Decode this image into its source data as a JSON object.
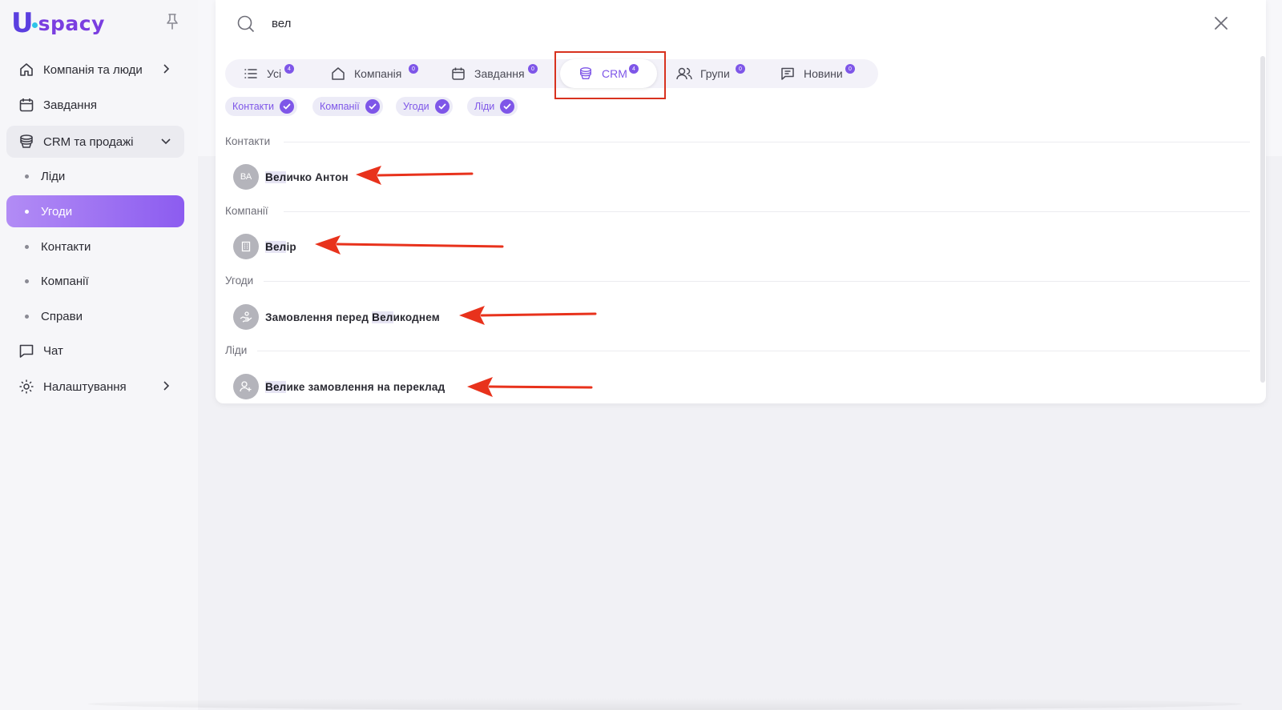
{
  "brand": {
    "logo_letter": "U",
    "logo_word": "spacy",
    "primary_color": "#7e56e8",
    "selected_gradient": [
      "#b28cf5",
      "#8c5cf0"
    ],
    "annotation_color": "#d8321f"
  },
  "sidebar": {
    "items": [
      {
        "label": "Компанія та люди",
        "icon": "home-icon",
        "has_chevron": "right"
      },
      {
        "label": "Завдання",
        "icon": "calendar-icon"
      },
      {
        "label": "CRM та продажі",
        "icon": "database-icon",
        "has_chevron": "down",
        "expanded": true,
        "children": [
          {
            "label": "Ліди"
          },
          {
            "label": "Угоди",
            "selected": true
          },
          {
            "label": "Контакти"
          },
          {
            "label": "Компанії"
          },
          {
            "label": "Справи"
          }
        ]
      },
      {
        "label": "Чат",
        "icon": "chat-icon"
      },
      {
        "label": "Налаштування",
        "icon": "gear-icon",
        "has_chevron": "right"
      }
    ]
  },
  "search": {
    "query": "вел",
    "tabs": [
      {
        "label": "Усі",
        "count": "4",
        "icon": "list-icon"
      },
      {
        "label": "Компанія",
        "count": "0",
        "icon": "home-icon"
      },
      {
        "label": "Завдання",
        "count": "0",
        "icon": "calendar-icon"
      },
      {
        "label": "CRM",
        "count": "4",
        "icon": "database-icon",
        "active": true
      },
      {
        "label": "Групи",
        "count": "0",
        "icon": "users-icon"
      },
      {
        "label": "Новини",
        "count": "0",
        "icon": "message-icon"
      }
    ],
    "filters": [
      {
        "label": "Контакти",
        "checked": true
      },
      {
        "label": "Компанії",
        "checked": true
      },
      {
        "label": "Угоди",
        "checked": true
      },
      {
        "label": "Ліди",
        "checked": true
      }
    ],
    "sections": [
      {
        "title": "Контакти",
        "result": {
          "avatar_text": "ВА",
          "match": "Вел",
          "rest_before": "",
          "rest_after": "ичко Антон"
        }
      },
      {
        "title": "Компанії",
        "result": {
          "avatar_icon": "building-icon",
          "match": "Вел",
          "rest_before": "",
          "rest_after": "ір"
        }
      },
      {
        "title": "Угоди",
        "result": {
          "avatar_icon": "handshake-icon",
          "match": "Вел",
          "rest_before": "Замовлення перед ",
          "rest_after": "икоднем"
        }
      },
      {
        "title": "Ліди",
        "result": {
          "avatar_icon": "user-plus-icon",
          "match": "Вел",
          "rest_before": "",
          "rest_after": "ике замовлення на переклад"
        }
      }
    ]
  }
}
